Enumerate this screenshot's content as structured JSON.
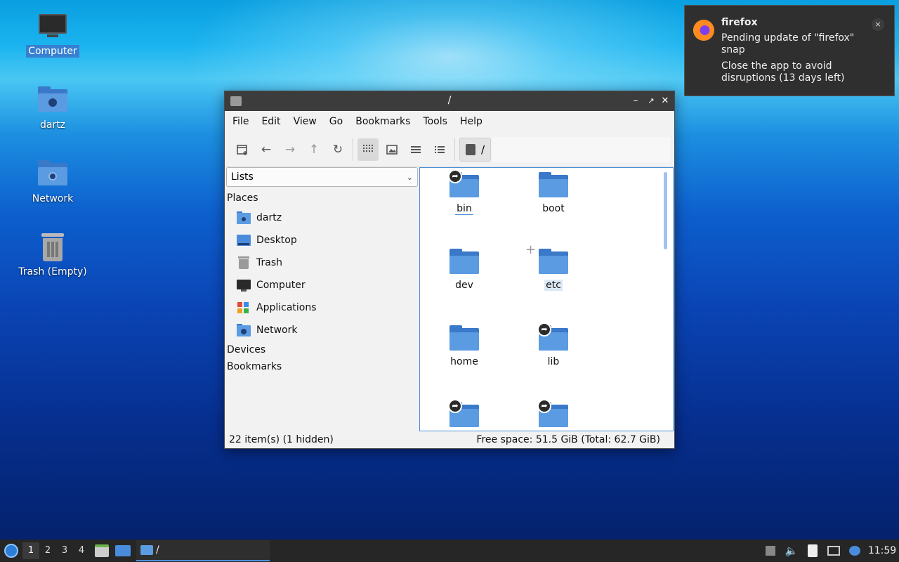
{
  "desktop": {
    "icons": [
      {
        "label": "Computer"
      },
      {
        "label": "dartz"
      },
      {
        "label": "Network"
      },
      {
        "label": "Trash (Empty)"
      }
    ]
  },
  "window": {
    "title": "/",
    "menu": [
      "File",
      "Edit",
      "View",
      "Go",
      "Bookmarks",
      "Tools",
      "Help"
    ],
    "path_label": "/",
    "side_combo": "Lists",
    "places_header": "Places",
    "places": [
      {
        "label": "dartz",
        "icon": "home-folder-icon"
      },
      {
        "label": "Desktop",
        "icon": "desktop-icon"
      },
      {
        "label": "Trash",
        "icon": "trash-icon"
      },
      {
        "label": "Computer",
        "icon": "computer-icon"
      },
      {
        "label": "Applications",
        "icon": "applications-icon"
      },
      {
        "label": "Network",
        "icon": "network-folder-icon"
      }
    ],
    "devices_header": "Devices",
    "bookmarks_header": "Bookmarks",
    "files": [
      {
        "name": "bin",
        "link": true
      },
      {
        "name": "boot",
        "link": false
      },
      {
        "name": "dev",
        "link": false
      },
      {
        "name": "etc",
        "link": false
      },
      {
        "name": "home",
        "link": false
      },
      {
        "name": "lib",
        "link": true
      },
      {
        "name": "",
        "link": true
      },
      {
        "name": "",
        "link": true
      }
    ],
    "status_left": "22 item(s) (1 hidden)",
    "status_right": "Free space: 51.5 GiB (Total: 62.7 GiB)"
  },
  "notification": {
    "app": "firefox",
    "line1": "Pending update of \"firefox\" snap",
    "line2": "Close the app to avoid disruptions (13 days left)",
    "close": "×"
  },
  "taskbar": {
    "workspaces": [
      "1",
      "2",
      "3",
      "4"
    ],
    "task_label": "/",
    "clock": "11:59"
  },
  "colors": {
    "folder_front": "#5b9be2",
    "folder_back": "#3a78c9",
    "accent": "#4a90d9"
  }
}
